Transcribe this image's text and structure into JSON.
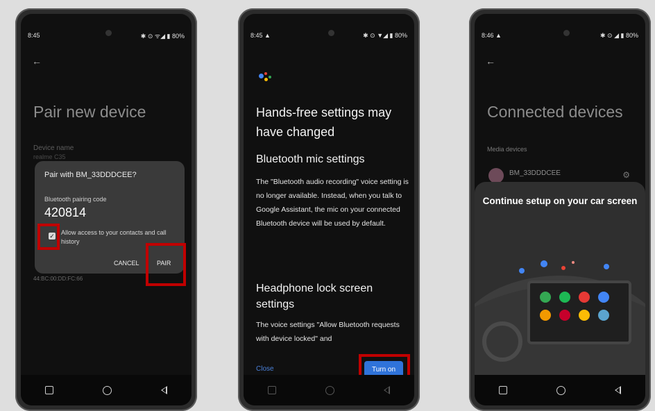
{
  "phone1": {
    "status": {
      "time": "8:45",
      "icons": "✱ ⊙ ᯤ◢ ▮ 80%"
    },
    "title": "Pair new device",
    "device_name_label": "Device name",
    "device_name_value": "realme C35",
    "mac_text": "44:BC:00:DD:FC:66",
    "dialog": {
      "title": "Pair with BM_33DDDCEE?",
      "code_label": "Bluetooth pairing code",
      "code": "420814",
      "checkbox_label": "Allow access to your contacts and call history",
      "cancel": "CANCEL",
      "pair": "PAIR"
    }
  },
  "phone2": {
    "status": {
      "time": "8:45 ▲",
      "icons": "✱ ⊙ ▼◢ ▮ 80%"
    },
    "heading": "Hands-free settings may have changed",
    "section1_title": "Bluetooth mic settings",
    "section1_text": "The \"Bluetooth audio recording\" voice setting is no longer available. Instead, when you talk to Google Assistant, the mic on your connected Bluetooth device will be used by default.",
    "section2_title": "Headphone lock screen settings",
    "section2_text": "The voice settings \"Allow Bluetooth requests with device locked\" and",
    "close": "Close",
    "turn_on": "Turn on"
  },
  "phone3": {
    "status": {
      "time": "8:46 ▲",
      "icons": "✱ ⊙ ◢ ▮ 80%"
    },
    "title": "Connected devices",
    "media_label": "Media devices",
    "device_name": "BM_33DDDCEE",
    "sheet_title": "Continue setup on your car screen"
  },
  "colors": {
    "highlight": "#c00000",
    "accent_blue": "#2f73d9"
  },
  "icons": [
    "back-arrow-icon",
    "square-nav-icon",
    "home-nav-icon",
    "back-nav-icon",
    "gear-icon",
    "assistant-icon"
  ]
}
